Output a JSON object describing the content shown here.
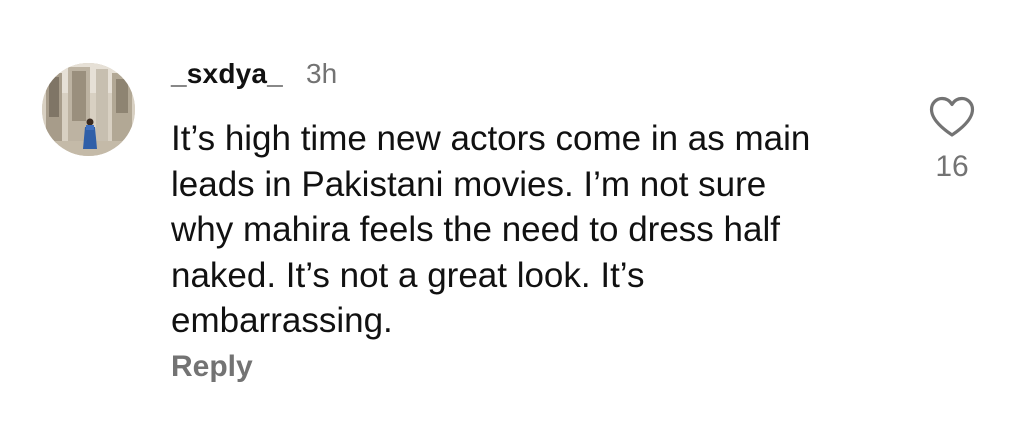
{
  "comment": {
    "username": "_sxdya_",
    "timestamp": "3h",
    "text_lines": [
      "It’s high time new actors come in as main",
      "leads in Pakistani movies. I’m not sure",
      "why mahira feels the need to dress half",
      "naked. It’s not a great look. It’s",
      "embarrassing."
    ],
    "reply_label": "Reply",
    "like_count": "16",
    "like_icon": "heart-outline-icon"
  }
}
